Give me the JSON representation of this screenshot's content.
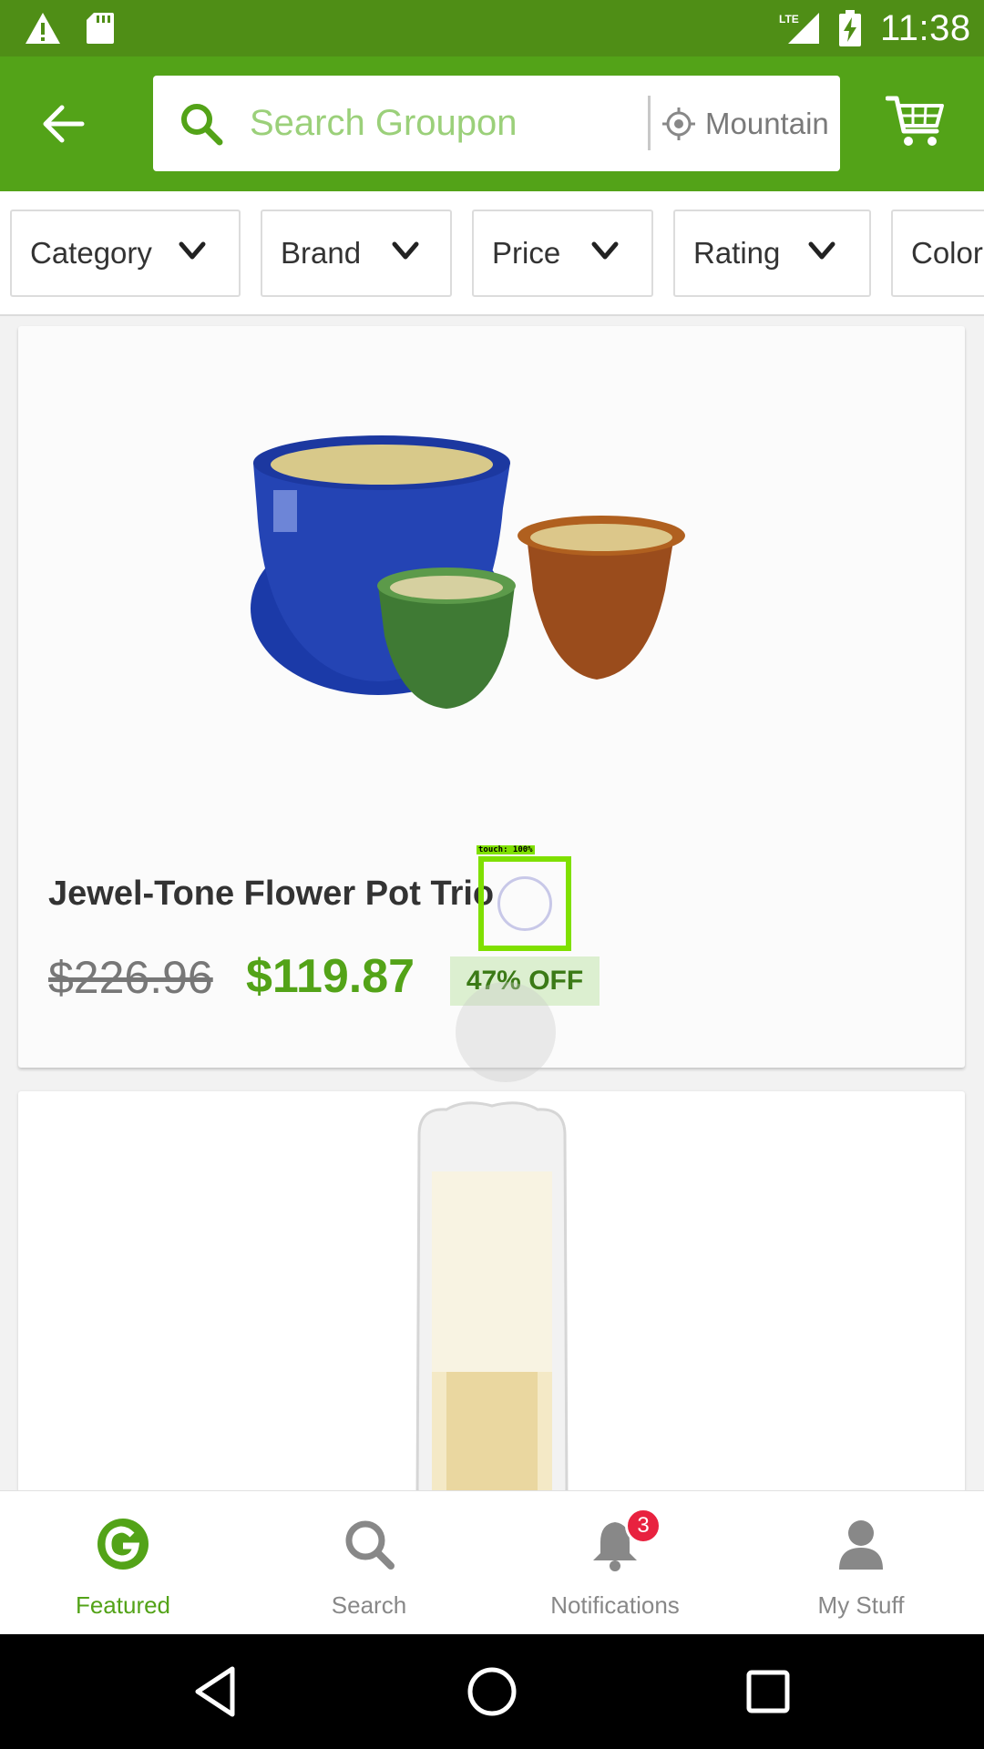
{
  "status_bar": {
    "time": "11:38",
    "network": "LTE",
    "icons": [
      "warning-icon",
      "sd-card-icon",
      "signal-icon",
      "battery-charging-icon"
    ]
  },
  "header": {
    "search_placeholder": "Search Groupon",
    "location": "Mountain View",
    "icons": [
      "back-arrow-icon",
      "search-icon",
      "location-target-icon",
      "cart-icon"
    ]
  },
  "filters": [
    {
      "label": "Category"
    },
    {
      "label": "Brand"
    },
    {
      "label": "Price"
    },
    {
      "label": "Rating"
    },
    {
      "label": "Color"
    }
  ],
  "product": {
    "title": "Jewel-Tone Flower Pot Trio",
    "original_price": "$226.96",
    "sale_price": "$119.87",
    "discount": "47% OFF"
  },
  "overlay": {
    "touch_label": "touch: 100%"
  },
  "bottom_nav": [
    {
      "label": "Featured",
      "icon": "groupon-g-icon",
      "active": true
    },
    {
      "label": "Search",
      "icon": "search-icon"
    },
    {
      "label": "Notifications",
      "icon": "bell-icon",
      "badge": "3"
    },
    {
      "label": "My Stuff",
      "icon": "person-icon"
    }
  ],
  "colors": {
    "brand_green": "#53a318",
    "status_green": "#4f8e16",
    "badge_red": "#e8223f",
    "discount_bg": "#dcefd0"
  }
}
